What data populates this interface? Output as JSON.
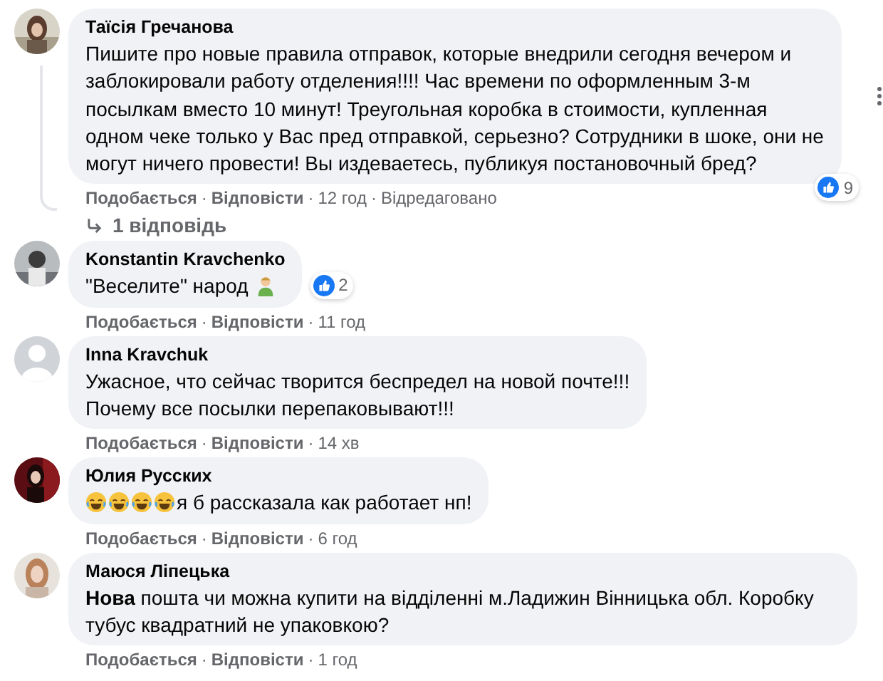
{
  "comments": [
    {
      "avatar": {
        "kind": "picture"
      },
      "author": "Таїсія Гречанова",
      "text": "Пишите про новые правила отправок, которые внедрили сегодня вечером и заблокировали работу отделения!!!! Час времени по оформленным 3-м посылкам вместо 10 минут! Треугольная коробка в стоимости, купленная одном чеке только у Вас пред отправкой, серьезно? Сотрудники в шоке, они не могут ничего провести! Вы издеваетесь, публикуя постановочный бред?",
      "reactions": "9",
      "meta": [
        {
          "kind": "action",
          "text": "Подобається"
        },
        {
          "kind": "dot",
          "text": "·"
        },
        {
          "kind": "action",
          "text": "Відповісти"
        },
        {
          "kind": "dot",
          "text": "·"
        },
        {
          "kind": "time",
          "text": "12 год"
        },
        {
          "kind": "dot",
          "text": "·"
        },
        {
          "kind": "note",
          "text": "Відредаговано"
        }
      ],
      "replies": "1 відповідь",
      "menu": true
    },
    {
      "avatar": {
        "kind": "picture"
      },
      "author": "Konstantin Kravchenko",
      "text": "\"Веселите\" народ",
      "trailing_icons": [
        {
          "kind": "person"
        }
      ],
      "reactions": "2",
      "meta": [
        {
          "kind": "action",
          "text": "Подобається"
        },
        {
          "kind": "dot",
          "text": "·"
        },
        {
          "kind": "action",
          "text": "Відповісти"
        },
        {
          "kind": "dot",
          "text": "·"
        },
        {
          "kind": "time",
          "text": "11 год"
        }
      ]
    },
    {
      "avatar": {
        "kind": "default"
      },
      "author": "Inna Kravchuk",
      "text": "Ужасное, что сейчас творится беспредел на новой почте!!!\nПочему все посылки перепаковывают!!!",
      "meta": [
        {
          "kind": "action",
          "text": "Подобається"
        },
        {
          "kind": "dot",
          "text": "·"
        },
        {
          "kind": "action",
          "text": "Відповісти"
        },
        {
          "kind": "dot",
          "text": "·"
        },
        {
          "kind": "time",
          "text": "14 хв"
        }
      ]
    },
    {
      "avatar": {
        "kind": "picture"
      },
      "author": "Юлия Русских",
      "leading_icons": [
        {
          "kind": "laugh"
        },
        {
          "kind": "laugh"
        },
        {
          "kind": "laugh"
        },
        {
          "kind": "laugh"
        }
      ],
      "text": "я б рассказала как работает нп!",
      "meta": [
        {
          "kind": "action",
          "text": "Подобається"
        },
        {
          "kind": "dot",
          "text": "·"
        },
        {
          "kind": "action",
          "text": "Відповісти"
        },
        {
          "kind": "dot",
          "text": "·"
        },
        {
          "kind": "time",
          "text": "6 год"
        }
      ]
    },
    {
      "avatar": {
        "kind": "picture"
      },
      "author": "Маюся Ліпецька",
      "text": "**Нова** пошта чи можна купити на відділенні м.Ладижин Вінницька обл. Коробку тубус квадратний не упаковкою?",
      "meta": [
        {
          "kind": "action",
          "text": "Подобається"
        },
        {
          "kind": "dot",
          "text": "·"
        },
        {
          "kind": "action",
          "text": "Відповісти"
        },
        {
          "kind": "dot",
          "text": "·"
        },
        {
          "kind": "time",
          "text": "1 год"
        }
      ]
    }
  ]
}
